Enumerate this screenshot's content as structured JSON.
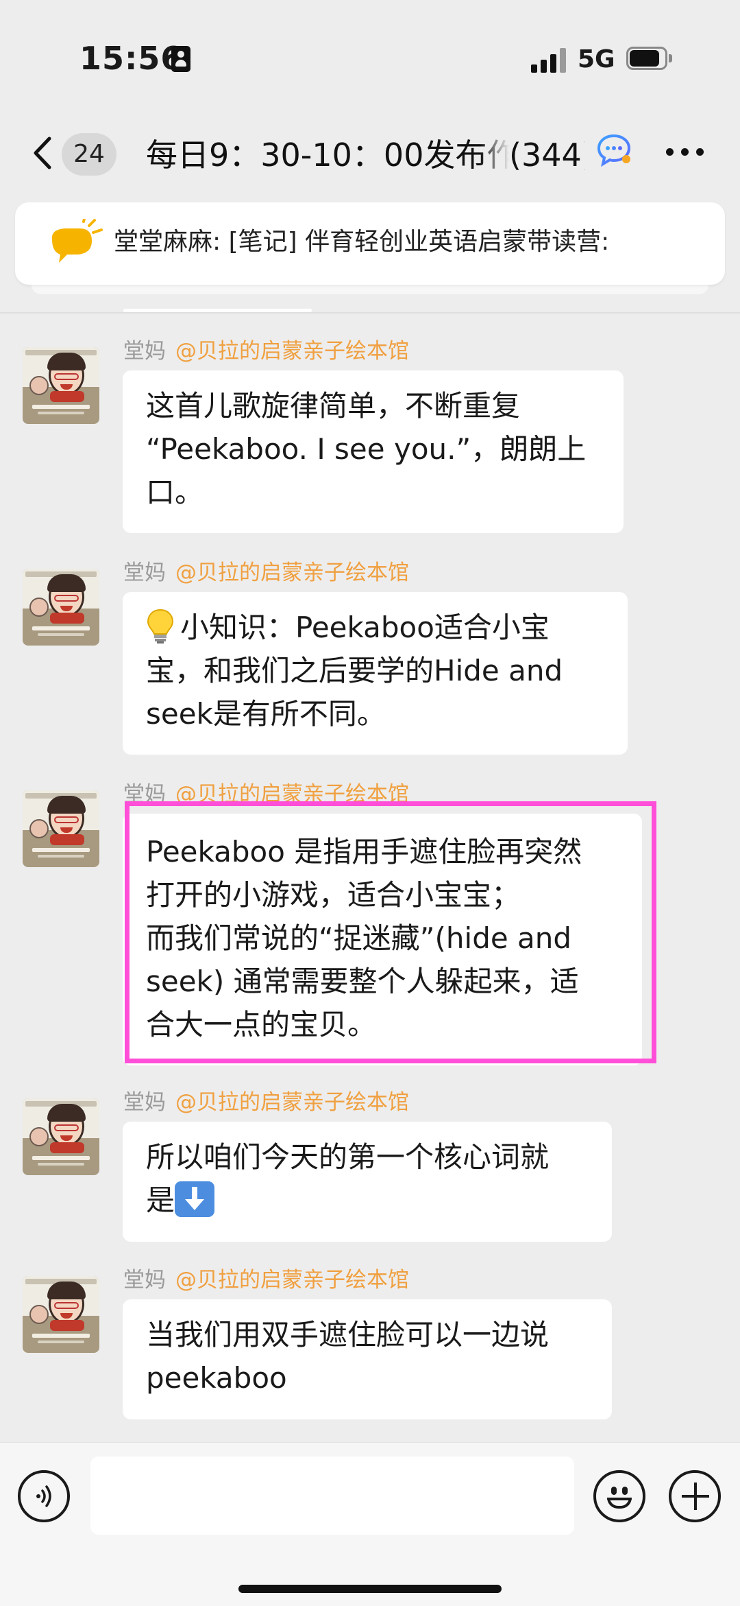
{
  "status_bar": {
    "time": "15:56",
    "network": "5G"
  },
  "header": {
    "unread_count": "24",
    "title": "每日9：30-10：00发布作",
    "member_count": "(344)"
  },
  "announcement": {
    "text": "堂堂麻麻: [笔记] 伴育轻创业英语启蒙带读营:"
  },
  "messages": [
    {
      "sender": "堂妈",
      "source": "@贝拉的启蒙亲子绘本馆",
      "lines": [
        "这首儿歌旋律简单，不断重复",
        "“Peekaboo. I see you.”，朗朗上",
        "口。"
      ]
    },
    {
      "sender": "堂妈",
      "source": "@贝拉的启蒙亲子绘本馆",
      "lines": [
        "小知识：Peekaboo适合小宝",
        "宝，和我们之后要学的Hide and",
        "seek是有所不同。"
      ]
    },
    {
      "sender": "堂妈",
      "source": "@贝拉的启蒙亲子绘本馆",
      "lines": [
        "Peekaboo 是指用手遮住脸再突然",
        "打开的小游戏，适合小宝宝；",
        "而我们常说的“捉迷藏”(hide and",
        "seek) 通常需要整个人躲起来，适",
        "合大一点的宝贝。"
      ]
    },
    {
      "sender": "堂妈",
      "source": "@贝拉的启蒙亲子绘本馆",
      "lines": [
        "所以咱们今天的第一个核心词就",
        "是"
      ]
    },
    {
      "sender": "堂妈",
      "source": "@贝拉的启蒙亲子绘本馆",
      "lines": [
        "当我们用双手遮住脸可以一边说",
        "peekaboo"
      ]
    }
  ],
  "input": {
    "placeholder": "",
    "value": ""
  },
  "icons": {
    "status": [
      "contact-card-icon",
      "signal-icon",
      "battery-icon"
    ],
    "header": [
      "back-chevron-icon",
      "chat-bubble-icon",
      "more-icon"
    ],
    "announcement": "megaphone-icon",
    "messages": [
      "lightbulb-icon",
      "down-arrow-icon"
    ],
    "input_bar": [
      "voice-icon",
      "emoji-icon",
      "add-icon"
    ]
  },
  "colors": {
    "background": "#ededed",
    "bubble": "#ffffff",
    "sender_name": "#9a9a9a",
    "sender_source": "#f0a040",
    "highlight": "#ff4fd8",
    "megaphone": "#f6b400"
  },
  "highlight": {
    "message_index": 2
  },
  "battery_level": 0.85
}
